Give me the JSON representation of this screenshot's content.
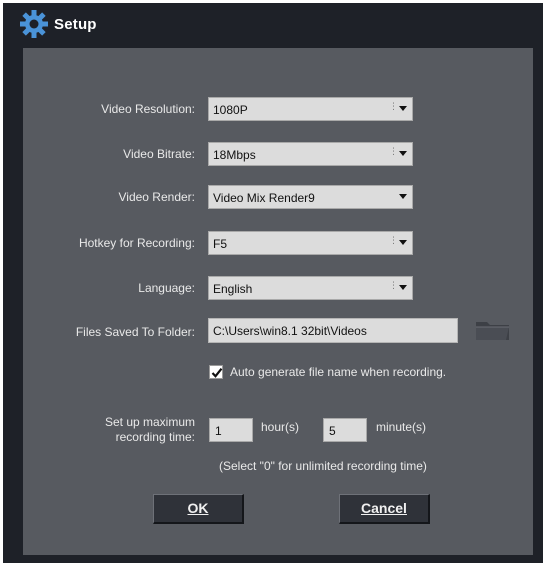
{
  "window": {
    "title": "Setup",
    "icon": "gear-icon"
  },
  "fields": {
    "video_resolution": {
      "label": "Video Resolution:",
      "value": "1080P"
    },
    "video_bitrate": {
      "label": "Video Bitrate:",
      "value": "18Mbps"
    },
    "video_render": {
      "label": "Video Render:",
      "value": "Video Mix Render9"
    },
    "hotkey": {
      "label": "Hotkey for Recording:",
      "value": "F5"
    },
    "language": {
      "label": "Language:",
      "value": "English"
    },
    "folder": {
      "label": "Files Saved To Folder:",
      "value": "C:\\Users\\win8.1 32bit\\Videos",
      "icon": "folder-icon"
    }
  },
  "auto_name": {
    "label": "Auto generate file name when recording.",
    "checked": true
  },
  "max_time": {
    "label_line1": "Set up maximum",
    "label_line2": "recording time:",
    "hours": "1",
    "hours_unit": "hour(s)",
    "minutes": "5",
    "minutes_unit": "minute(s)",
    "note": "(Select \"0\" for unlimited recording time)"
  },
  "buttons": {
    "ok": "OK",
    "cancel": "Cancel"
  },
  "colors": {
    "titlebar": "#1e2128",
    "panel": "#575a60",
    "field": "#dcdcdc",
    "button": "#2f3239"
  }
}
